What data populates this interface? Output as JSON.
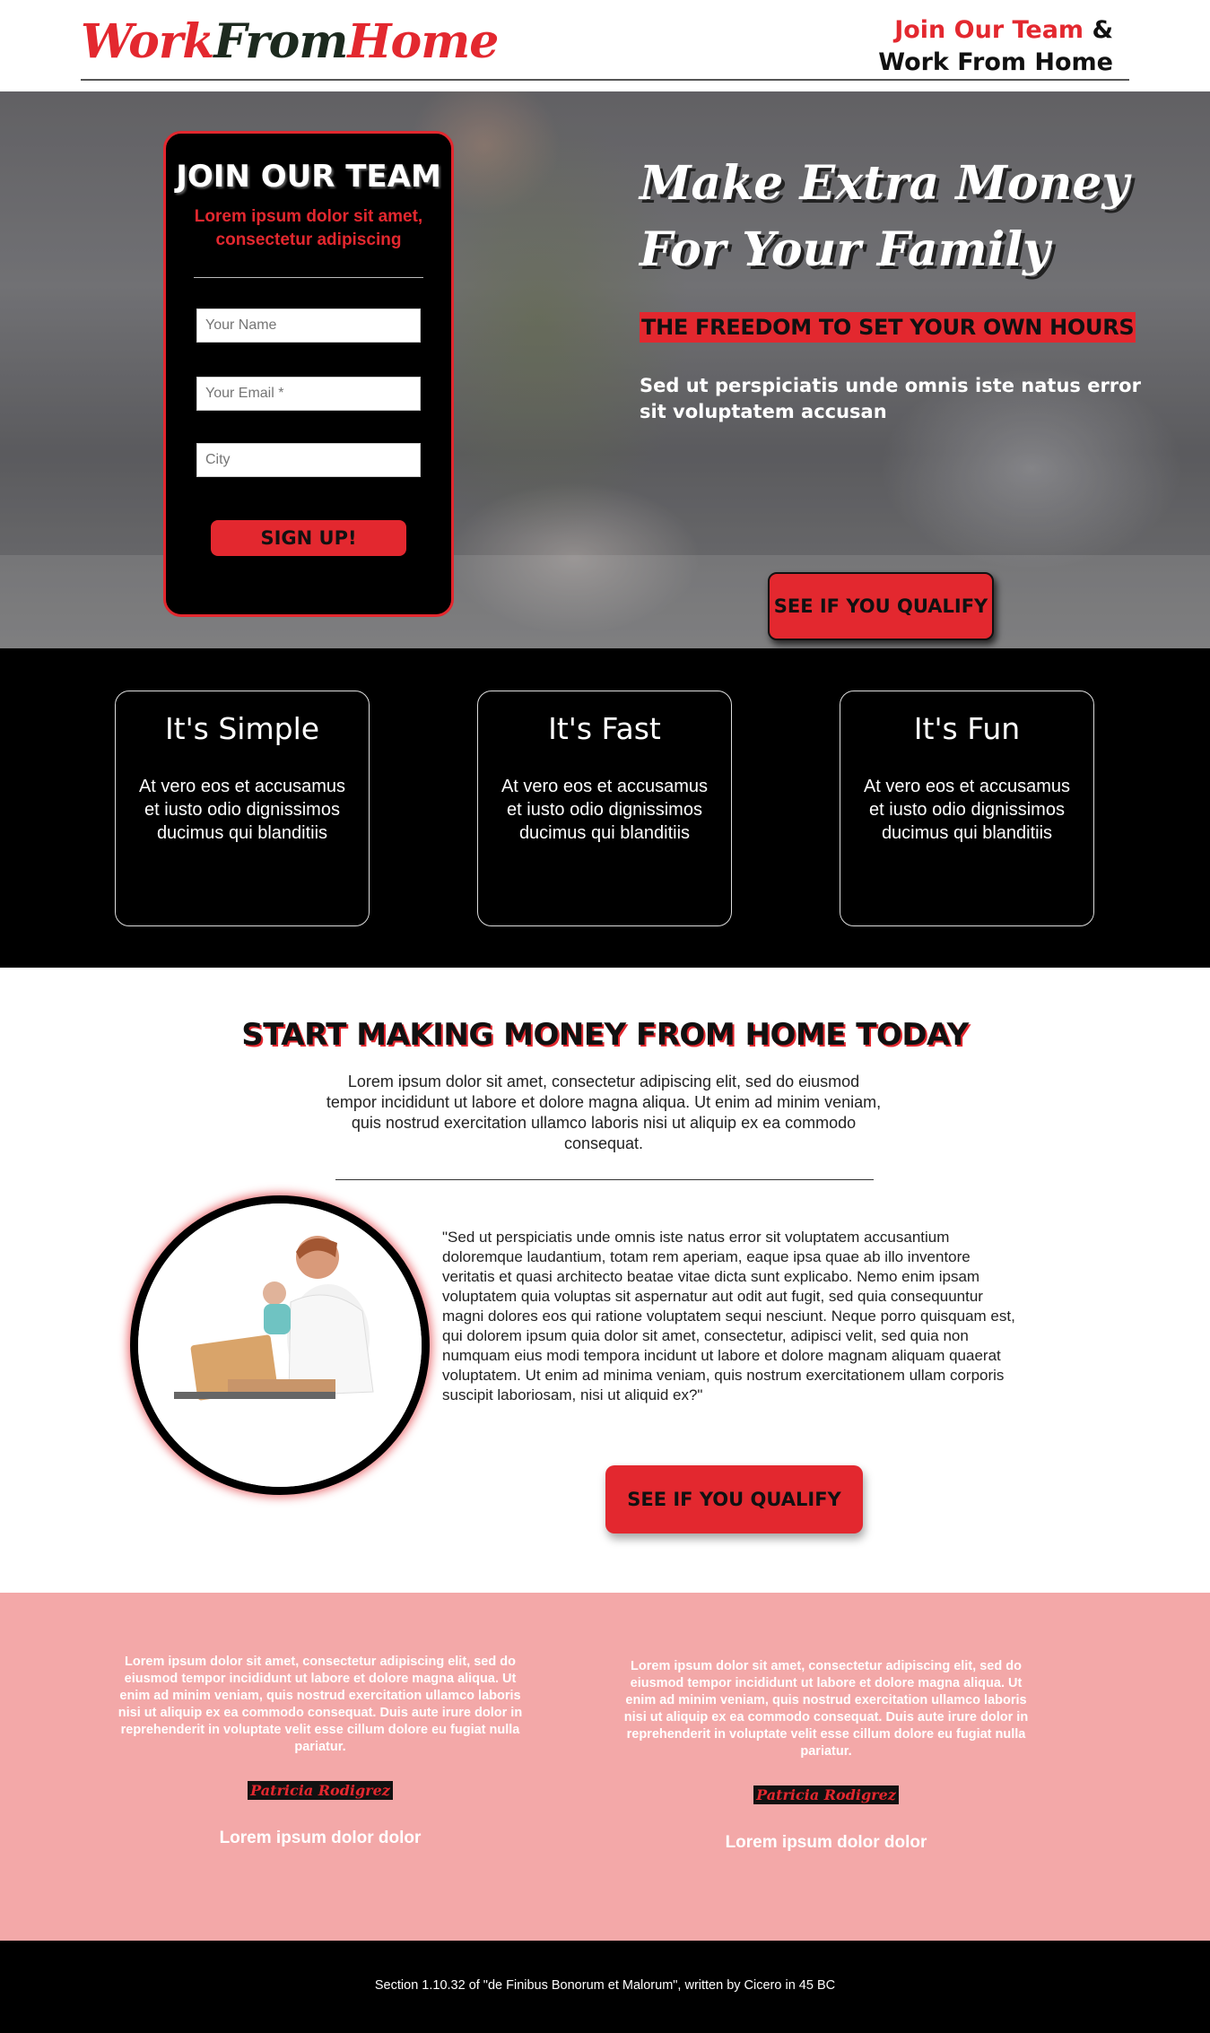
{
  "header": {
    "logo_part1": "Work",
    "logo_part2": "From",
    "logo_part3": "Home",
    "right_line1_red": "Join Our Team",
    "right_line1_amp": " &",
    "right_line2": "Work From Home"
  },
  "hero": {
    "form": {
      "title": "JOIN OUR TEAM",
      "subtitle": "Lorem ipsum dolor sit amet, consectetur adipiscing",
      "name_placeholder": "Your Name",
      "email_placeholder": "Your Email *",
      "city_placeholder": "City",
      "submit_label": "SIGN UP!"
    },
    "headline_line1": "Make Extra Money",
    "headline_line2": "For Your Family",
    "tagline": "THE FREEDOM TO SET YOUR OWN HOURS",
    "description": "Sed ut perspiciatis unde omnis iste natus error sit voluptatem accusan",
    "cta_label": "SEE IF YOU QUALIFY"
  },
  "features": [
    {
      "title": "It's Simple",
      "text": "At vero eos et accusamus et iusto odio dignissimos ducimus qui blanditiis"
    },
    {
      "title": "It's Fast",
      "text": "At vero eos et accusamus et iusto odio dignissimos ducimus qui blanditiis"
    },
    {
      "title": "It's Fun",
      "text": "At vero eos et accusamus et iusto odio dignissimos ducimus qui blanditiis"
    }
  ],
  "start": {
    "title": "START MAKING MONEY FROM HOME TODAY",
    "description": "Lorem ipsum dolor sit amet, consectetur adipiscing elit, sed do eiusmod tempor incididunt ut labore et dolore magna aliqua. Ut enim ad minim veniam, quis nostrud exercitation ullamco laboris nisi ut aliquip ex ea commodo consequat.",
    "quote": "\"Sed ut perspiciatis unde omnis iste natus error sit voluptatem accusantium doloremque laudantium, totam rem aperiam, eaque ipsa quae ab illo inventore veritatis et quasi architecto beatae vitae dicta sunt explicabo. Nemo enim ipsam voluptatem quia voluptas sit aspernatur aut odit aut fugit, sed quia consequuntur magni dolores eos qui ratione voluptatem sequi nesciunt. Neque porro quisquam est, qui dolorem ipsum quia dolor sit amet, consectetur, adipisci velit, sed quia non numquam eius modi tempora incidunt ut labore et dolore magnam aliquam quaerat voluptatem. Ut enim ad minima veniam, quis nostrum exercitationem ullam corporis suscipit laboriosam, nisi ut aliquid ex?\"",
    "cta_label": "SEE IF YOU QUALIFY"
  },
  "testimonials": [
    {
      "text": "Lorem ipsum dolor sit amet, consectetur adipiscing elit, sed do eiusmod tempor incididunt ut labore et dolore magna aliqua. Ut enim ad minim veniam, quis nostrud exercitation ullamco laboris nisi ut aliquip ex ea commodo consequat. Duis aute irure dolor in reprehenderit in voluptate velit esse cillum dolore eu fugiat nulla pariatur.",
      "name": "Patricia  Rodigrez",
      "role": "Lorem ipsum dolor dolor"
    },
    {
      "text": "Lorem ipsum dolor sit amet, consectetur adipiscing elit, sed do eiusmod tempor incididunt ut labore et dolore magna aliqua. Ut enim ad minim veniam, quis nostrud exercitation ullamco laboris nisi ut aliquip ex ea commodo consequat. Duis aute irure dolor in reprehenderit in voluptate velit esse cillum dolore eu fugiat nulla pariatur.",
      "name": "Patricia  Rodigrez",
      "role": "Lorem ipsum dolor dolor"
    }
  ],
  "footer": {
    "text": "Section 1.10.32 of \"de Finibus Bonorum et Malorum\", written by Cicero in 45 BC"
  },
  "colors": {
    "accent": "#e3282f",
    "testimonial_bg": "#f3a8a8",
    "dark": "#000000"
  }
}
